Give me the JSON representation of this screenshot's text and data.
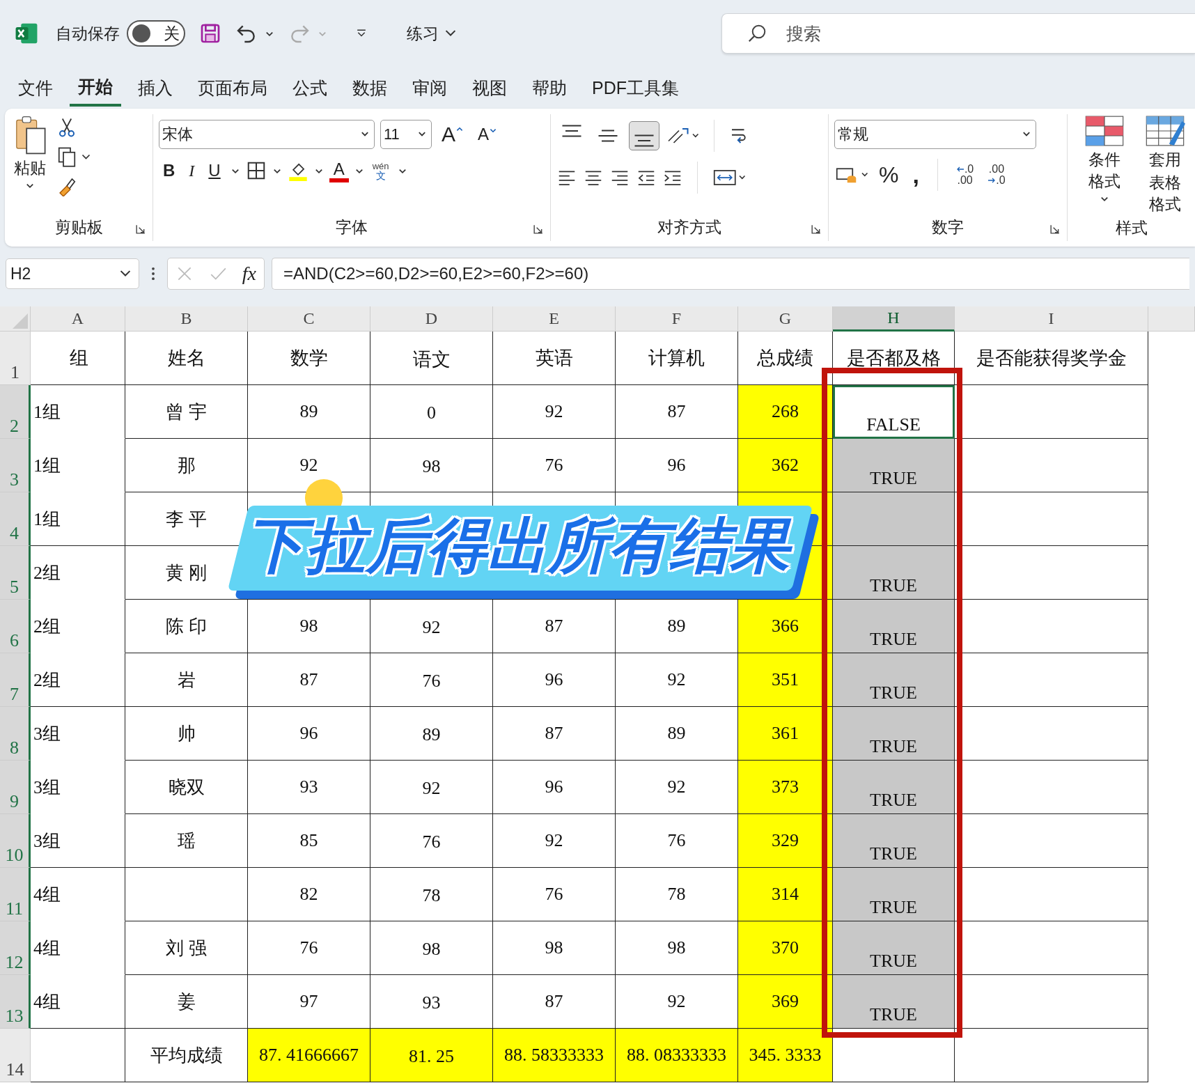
{
  "titlebar": {
    "autosave_label": "自动保存",
    "autosave_toggle": {
      "label": "关",
      "on": false
    },
    "file_name": "练习",
    "search": {
      "placeholder": "搜索"
    }
  },
  "ribbon_tabs": [
    {
      "label": "文件",
      "selected": false
    },
    {
      "label": "开始",
      "selected": true
    },
    {
      "label": "插入",
      "selected": false
    },
    {
      "label": "页面布局",
      "selected": false
    },
    {
      "label": "公式",
      "selected": false
    },
    {
      "label": "数据",
      "selected": false
    },
    {
      "label": "审阅",
      "selected": false
    },
    {
      "label": "视图",
      "selected": false
    },
    {
      "label": "帮助",
      "selected": false
    },
    {
      "label": "PDF工具集",
      "selected": false
    }
  ],
  "ribbon": {
    "clipboard": {
      "paste": "粘贴",
      "title": "剪贴板"
    },
    "font": {
      "name": "宋体",
      "size": "11",
      "grow": "A",
      "shrink": "A",
      "bold": "B",
      "italic": "I",
      "underline": "U",
      "font_color_letter": "A",
      "phonetic_top": "wén",
      "phonetic_bottom": "文",
      "title": "字体"
    },
    "alignment": {
      "vertical": [
        {
          "kind": "top",
          "selected": false
        },
        {
          "kind": "middle",
          "selected": false
        },
        {
          "kind": "bottom",
          "selected": true
        }
      ],
      "title": "对齐方式"
    },
    "number": {
      "format": "常规",
      "percent": "%",
      "comma": ",",
      "increase_decimal": [
        ".0",
        ".00"
      ],
      "decrease_decimal": [
        ".00",
        ".0"
      ],
      "title": "数字"
    },
    "styles": {
      "conditional": "条件格式",
      "table_format": [
        "套用",
        "表格格式"
      ],
      "title": "样式"
    }
  },
  "formula_bar": {
    "cell_ref": "H2",
    "fx": "fx",
    "formula": "=AND(C2>=60,D2>=60,E2>=60,F2>=60)"
  },
  "columns": [
    {
      "label": "A",
      "selected": false
    },
    {
      "label": "B",
      "selected": false
    },
    {
      "label": "C",
      "selected": false
    },
    {
      "label": "D",
      "selected": false
    },
    {
      "label": "E",
      "selected": false
    },
    {
      "label": "F",
      "selected": false
    },
    {
      "label": "G",
      "selected": false
    },
    {
      "label": "H",
      "selected": true
    },
    {
      "label": "I",
      "selected": false
    }
  ],
  "rows": [
    {
      "number": "1",
      "selected": false,
      "cells": [
        {
          "text": "组"
        },
        {
          "text": "姓名"
        },
        {
          "text": "数学"
        },
        {
          "text": "语文"
        },
        {
          "text": "英语"
        },
        {
          "text": "计算机"
        },
        {
          "text": "总成绩"
        },
        {
          "text": "是否都及格"
        },
        {
          "text": "是否能获得奖学金"
        }
      ]
    },
    {
      "number": "2",
      "selected": true,
      "cells": [
        {
          "text": "1组"
        },
        {
          "text": "曾 宇"
        },
        {
          "text": "89"
        },
        {
          "text": "0"
        },
        {
          "text": "92"
        },
        {
          "text": "87"
        },
        {
          "text": "268",
          "highlighted": true
        },
        {
          "text": "FALSE",
          "active": true
        },
        {}
      ]
    },
    {
      "number": "3",
      "selected": true,
      "cells": [
        {
          "text": "1组"
        },
        {
          "text": "那"
        },
        {
          "text": "92"
        },
        {
          "text": "98"
        },
        {
          "text": "76"
        },
        {
          "text": "96"
        },
        {
          "text": "362",
          "highlighted": true
        },
        {
          "text": "TRUE",
          "active": false
        },
        {}
      ]
    },
    {
      "number": "4",
      "selected": true,
      "cells": [
        {
          "text": "1组"
        },
        {
          "text": "李 平"
        },
        {},
        {},
        {},
        {},
        {
          "highlighted": true
        },
        {
          "active": false
        },
        {}
      ]
    },
    {
      "number": "5",
      "selected": true,
      "cells": [
        {
          "text": "2组"
        },
        {
          "text": "黄 刚"
        },
        {},
        {},
        {},
        {},
        {
          "highlighted": true
        },
        {
          "text": "TRUE",
          "active": false
        },
        {}
      ]
    },
    {
      "number": "6",
      "selected": true,
      "cells": [
        {
          "text": "2组"
        },
        {
          "text": "陈 印"
        },
        {
          "text": "98"
        },
        {
          "text": "92"
        },
        {
          "text": "87"
        },
        {
          "text": "89"
        },
        {
          "text": "366",
          "highlighted": true
        },
        {
          "text": "TRUE",
          "active": false
        },
        {}
      ]
    },
    {
      "number": "7",
      "selected": true,
      "cells": [
        {
          "text": "2组"
        },
        {
          "text": "岩"
        },
        {
          "text": "87"
        },
        {
          "text": "76"
        },
        {
          "text": "96"
        },
        {
          "text": "92"
        },
        {
          "text": "351",
          "highlighted": true
        },
        {
          "text": "TRUE",
          "active": false
        },
        {}
      ]
    },
    {
      "number": "8",
      "selected": true,
      "cells": [
        {
          "text": "3组"
        },
        {
          "text": "帅"
        },
        {
          "text": "96"
        },
        {
          "text": "89"
        },
        {
          "text": "87"
        },
        {
          "text": "89"
        },
        {
          "text": "361",
          "highlighted": true
        },
        {
          "text": "TRUE",
          "active": false
        },
        {}
      ]
    },
    {
      "number": "9",
      "selected": true,
      "cells": [
        {
          "text": "3组"
        },
        {
          "text": "晓双"
        },
        {
          "text": "93"
        },
        {
          "text": "92"
        },
        {
          "text": "96"
        },
        {
          "text": "92"
        },
        {
          "text": "373",
          "highlighted": true
        },
        {
          "text": "TRUE",
          "active": false
        },
        {}
      ]
    },
    {
      "number": "10",
      "selected": true,
      "cells": [
        {
          "text": "3组"
        },
        {
          "text": "瑶"
        },
        {
          "text": "85"
        },
        {
          "text": "76"
        },
        {
          "text": "92"
        },
        {
          "text": "76"
        },
        {
          "text": "329",
          "highlighted": true
        },
        {
          "text": "TRUE",
          "active": false
        },
        {}
      ]
    },
    {
      "number": "11",
      "selected": true,
      "cells": [
        {
          "text": "4组"
        },
        {},
        {
          "text": "82"
        },
        {
          "text": "78"
        },
        {
          "text": "76"
        },
        {
          "text": "78"
        },
        {
          "text": "314",
          "highlighted": true
        },
        {
          "text": "TRUE",
          "active": false
        },
        {}
      ]
    },
    {
      "number": "12",
      "selected": true,
      "cells": [
        {
          "text": "4组"
        },
        {
          "text": "刘 强"
        },
        {
          "text": "76"
        },
        {
          "text": "98"
        },
        {
          "text": "98"
        },
        {
          "text": "98"
        },
        {
          "text": "370",
          "highlighted": true
        },
        {
          "text": "TRUE",
          "active": false
        },
        {}
      ]
    },
    {
      "number": "13",
      "selected": true,
      "cells": [
        {
          "text": "4组"
        },
        {
          "text": "姜"
        },
        {
          "text": "97"
        },
        {
          "text": "93"
        },
        {
          "text": "87"
        },
        {
          "text": "92"
        },
        {
          "text": "369",
          "highlighted": true
        },
        {
          "text": "TRUE",
          "active": false
        },
        {}
      ]
    },
    {
      "number": "14",
      "selected": false,
      "cells": [
        {},
        {
          "text": "平均成绩"
        },
        {
          "text": "87. 41666667",
          "highlighted": true
        },
        {
          "text": "81. 25",
          "highlighted": true
        },
        {
          "text": "88. 58333333",
          "highlighted": true
        },
        {
          "text": "88. 08333333",
          "highlighted": true
        },
        {
          "text": "345. 3333",
          "highlighted": true
        },
        {},
        {}
      ]
    }
  ],
  "banner": {
    "text": "下拉后得出所有结果"
  }
}
